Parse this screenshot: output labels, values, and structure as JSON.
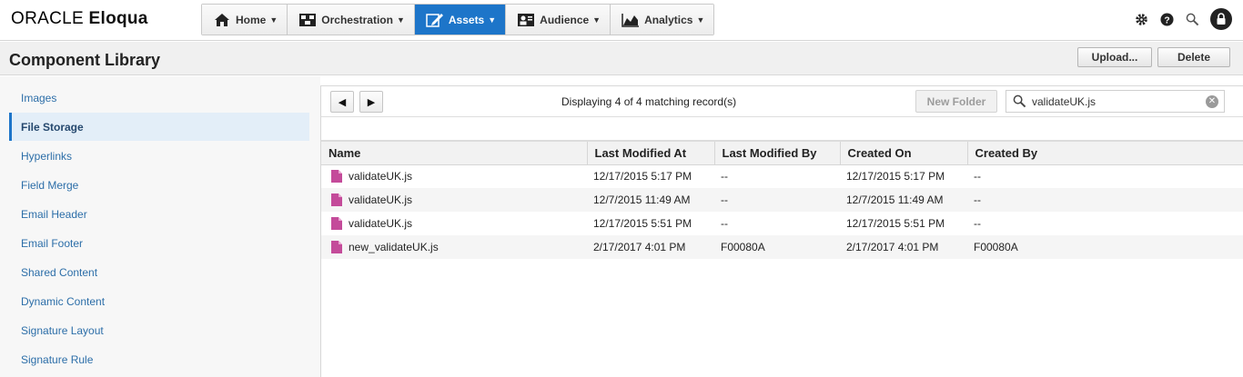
{
  "brand": {
    "oracle": "ORACLE",
    "product": "Eloqua"
  },
  "nav": [
    {
      "label": "Home",
      "icon": "home-icon",
      "active": false
    },
    {
      "label": "Orchestration",
      "icon": "orchestration-icon",
      "active": false
    },
    {
      "label": "Assets",
      "icon": "assets-pencil-icon",
      "active": true
    },
    {
      "label": "Audience",
      "icon": "audience-icon",
      "active": false
    },
    {
      "label": "Analytics",
      "icon": "analytics-chart-icon",
      "active": false
    }
  ],
  "top_icons": [
    "gear-icon",
    "help-icon",
    "search-icon",
    "user-avatar-icon"
  ],
  "page": {
    "title": "Component Library",
    "upload_label": "Upload...",
    "delete_label": "Delete"
  },
  "sidebar": {
    "items": [
      {
        "label": "Images",
        "active": false
      },
      {
        "label": "File Storage",
        "active": true
      },
      {
        "label": "Hyperlinks",
        "active": false
      },
      {
        "label": "Field Merge",
        "active": false
      },
      {
        "label": "Email Header",
        "active": false
      },
      {
        "label": "Email Footer",
        "active": false
      },
      {
        "label": "Shared Content",
        "active": false
      },
      {
        "label": "Dynamic Content",
        "active": false
      },
      {
        "label": "Signature Layout",
        "active": false
      },
      {
        "label": "Signature Rule",
        "active": false
      }
    ]
  },
  "toolbar": {
    "prev_symbol": "◀",
    "next_symbol": "▶",
    "record_count": "Displaying 4 of 4 matching record(s)",
    "new_folder_label": "New Folder",
    "search_value": "validateUK.js"
  },
  "table": {
    "columns": [
      "Name",
      "Last Modified At",
      "Last Modified By",
      "Created On",
      "Created By"
    ],
    "rows": [
      {
        "name": "validateUK.js",
        "modified_at": "12/17/2015 5:17 PM",
        "modified_by": "--",
        "created_on": "12/17/2015 5:17 PM",
        "created_by": "--"
      },
      {
        "name": "validateUK.js",
        "modified_at": "12/7/2015 11:49 AM",
        "modified_by": "--",
        "created_on": "12/7/2015 11:49 AM",
        "created_by": "--"
      },
      {
        "name": "validateUK.js",
        "modified_at": "12/17/2015 5:51 PM",
        "modified_by": "--",
        "created_on": "12/17/2015 5:51 PM",
        "created_by": "--"
      },
      {
        "name": "new_validateUK.js",
        "modified_at": "2/17/2017 4:01 PM",
        "modified_by": "F00080A",
        "created_on": "2/17/2017 4:01 PM",
        "created_by": "F00080A"
      }
    ]
  },
  "colors": {
    "accent": "#1d75c9",
    "file_icon": "#c44b9a",
    "link": "#2c6ea8"
  }
}
